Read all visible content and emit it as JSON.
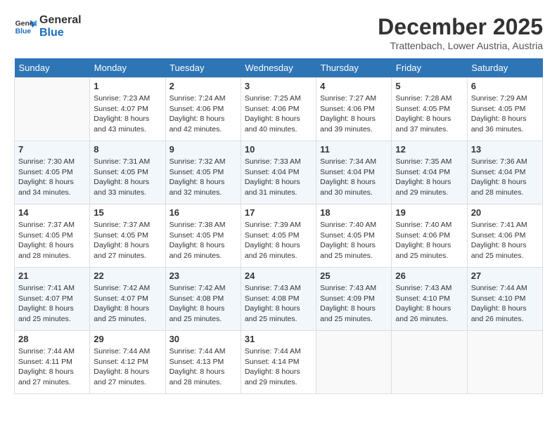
{
  "logo": {
    "line1": "General",
    "line2": "Blue"
  },
  "title": "December 2025",
  "location": "Trattenbach, Lower Austria, Austria",
  "days_of_week": [
    "Sunday",
    "Monday",
    "Tuesday",
    "Wednesday",
    "Thursday",
    "Friday",
    "Saturday"
  ],
  "weeks": [
    [
      {
        "day": null,
        "sunrise": null,
        "sunset": null,
        "daylight": null
      },
      {
        "day": "1",
        "sunrise": "Sunrise: 7:23 AM",
        "sunset": "Sunset: 4:07 PM",
        "daylight": "Daylight: 8 hours and 43 minutes."
      },
      {
        "day": "2",
        "sunrise": "Sunrise: 7:24 AM",
        "sunset": "Sunset: 4:06 PM",
        "daylight": "Daylight: 8 hours and 42 minutes."
      },
      {
        "day": "3",
        "sunrise": "Sunrise: 7:25 AM",
        "sunset": "Sunset: 4:06 PM",
        "daylight": "Daylight: 8 hours and 40 minutes."
      },
      {
        "day": "4",
        "sunrise": "Sunrise: 7:27 AM",
        "sunset": "Sunset: 4:06 PM",
        "daylight": "Daylight: 8 hours and 39 minutes."
      },
      {
        "day": "5",
        "sunrise": "Sunrise: 7:28 AM",
        "sunset": "Sunset: 4:05 PM",
        "daylight": "Daylight: 8 hours and 37 minutes."
      },
      {
        "day": "6",
        "sunrise": "Sunrise: 7:29 AM",
        "sunset": "Sunset: 4:05 PM",
        "daylight": "Daylight: 8 hours and 36 minutes."
      }
    ],
    [
      {
        "day": "7",
        "sunrise": "Sunrise: 7:30 AM",
        "sunset": "Sunset: 4:05 PM",
        "daylight": "Daylight: 8 hours and 34 minutes."
      },
      {
        "day": "8",
        "sunrise": "Sunrise: 7:31 AM",
        "sunset": "Sunset: 4:05 PM",
        "daylight": "Daylight: 8 hours and 33 minutes."
      },
      {
        "day": "9",
        "sunrise": "Sunrise: 7:32 AM",
        "sunset": "Sunset: 4:05 PM",
        "daylight": "Daylight: 8 hours and 32 minutes."
      },
      {
        "day": "10",
        "sunrise": "Sunrise: 7:33 AM",
        "sunset": "Sunset: 4:04 PM",
        "daylight": "Daylight: 8 hours and 31 minutes."
      },
      {
        "day": "11",
        "sunrise": "Sunrise: 7:34 AM",
        "sunset": "Sunset: 4:04 PM",
        "daylight": "Daylight: 8 hours and 30 minutes."
      },
      {
        "day": "12",
        "sunrise": "Sunrise: 7:35 AM",
        "sunset": "Sunset: 4:04 PM",
        "daylight": "Daylight: 8 hours and 29 minutes."
      },
      {
        "day": "13",
        "sunrise": "Sunrise: 7:36 AM",
        "sunset": "Sunset: 4:04 PM",
        "daylight": "Daylight: 8 hours and 28 minutes."
      }
    ],
    [
      {
        "day": "14",
        "sunrise": "Sunrise: 7:37 AM",
        "sunset": "Sunset: 4:05 PM",
        "daylight": "Daylight: 8 hours and 28 minutes."
      },
      {
        "day": "15",
        "sunrise": "Sunrise: 7:37 AM",
        "sunset": "Sunset: 4:05 PM",
        "daylight": "Daylight: 8 hours and 27 minutes."
      },
      {
        "day": "16",
        "sunrise": "Sunrise: 7:38 AM",
        "sunset": "Sunset: 4:05 PM",
        "daylight": "Daylight: 8 hours and 26 minutes."
      },
      {
        "day": "17",
        "sunrise": "Sunrise: 7:39 AM",
        "sunset": "Sunset: 4:05 PM",
        "daylight": "Daylight: 8 hours and 26 minutes."
      },
      {
        "day": "18",
        "sunrise": "Sunrise: 7:40 AM",
        "sunset": "Sunset: 4:05 PM",
        "daylight": "Daylight: 8 hours and 25 minutes."
      },
      {
        "day": "19",
        "sunrise": "Sunrise: 7:40 AM",
        "sunset": "Sunset: 4:06 PM",
        "daylight": "Daylight: 8 hours and 25 minutes."
      },
      {
        "day": "20",
        "sunrise": "Sunrise: 7:41 AM",
        "sunset": "Sunset: 4:06 PM",
        "daylight": "Daylight: 8 hours and 25 minutes."
      }
    ],
    [
      {
        "day": "21",
        "sunrise": "Sunrise: 7:41 AM",
        "sunset": "Sunset: 4:07 PM",
        "daylight": "Daylight: 8 hours and 25 minutes."
      },
      {
        "day": "22",
        "sunrise": "Sunrise: 7:42 AM",
        "sunset": "Sunset: 4:07 PM",
        "daylight": "Daylight: 8 hours and 25 minutes."
      },
      {
        "day": "23",
        "sunrise": "Sunrise: 7:42 AM",
        "sunset": "Sunset: 4:08 PM",
        "daylight": "Daylight: 8 hours and 25 minutes."
      },
      {
        "day": "24",
        "sunrise": "Sunrise: 7:43 AM",
        "sunset": "Sunset: 4:08 PM",
        "daylight": "Daylight: 8 hours and 25 minutes."
      },
      {
        "day": "25",
        "sunrise": "Sunrise: 7:43 AM",
        "sunset": "Sunset: 4:09 PM",
        "daylight": "Daylight: 8 hours and 25 minutes."
      },
      {
        "day": "26",
        "sunrise": "Sunrise: 7:43 AM",
        "sunset": "Sunset: 4:10 PM",
        "daylight": "Daylight: 8 hours and 26 minutes."
      },
      {
        "day": "27",
        "sunrise": "Sunrise: 7:44 AM",
        "sunset": "Sunset: 4:10 PM",
        "daylight": "Daylight: 8 hours and 26 minutes."
      }
    ],
    [
      {
        "day": "28",
        "sunrise": "Sunrise: 7:44 AM",
        "sunset": "Sunset: 4:11 PM",
        "daylight": "Daylight: 8 hours and 27 minutes."
      },
      {
        "day": "29",
        "sunrise": "Sunrise: 7:44 AM",
        "sunset": "Sunset: 4:12 PM",
        "daylight": "Daylight: 8 hours and 27 minutes."
      },
      {
        "day": "30",
        "sunrise": "Sunrise: 7:44 AM",
        "sunset": "Sunset: 4:13 PM",
        "daylight": "Daylight: 8 hours and 28 minutes."
      },
      {
        "day": "31",
        "sunrise": "Sunrise: 7:44 AM",
        "sunset": "Sunset: 4:14 PM",
        "daylight": "Daylight: 8 hours and 29 minutes."
      },
      {
        "day": null,
        "sunrise": null,
        "sunset": null,
        "daylight": null
      },
      {
        "day": null,
        "sunrise": null,
        "sunset": null,
        "daylight": null
      },
      {
        "day": null,
        "sunrise": null,
        "sunset": null,
        "daylight": null
      }
    ]
  ]
}
